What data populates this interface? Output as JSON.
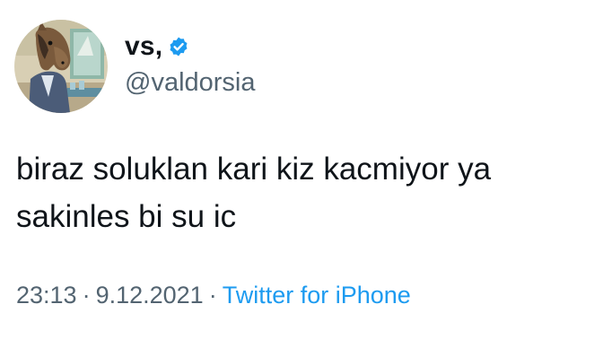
{
  "author": {
    "display_name": "vs,",
    "handle": "@valdorsia",
    "verified": true,
    "avatar_icon": "bojack-horseman-avatar"
  },
  "tweet": {
    "text": "biraz soluklan kari kiz kacmiyor ya\nsakinles bi su ic"
  },
  "meta": {
    "time": "23:13",
    "separator": "·",
    "date": "9.12.2021",
    "source": "Twitter for iPhone"
  },
  "colors": {
    "text": "#0f1419",
    "secondary": "#536471",
    "accent": "#1d9bf0",
    "background": "#ffffff"
  }
}
